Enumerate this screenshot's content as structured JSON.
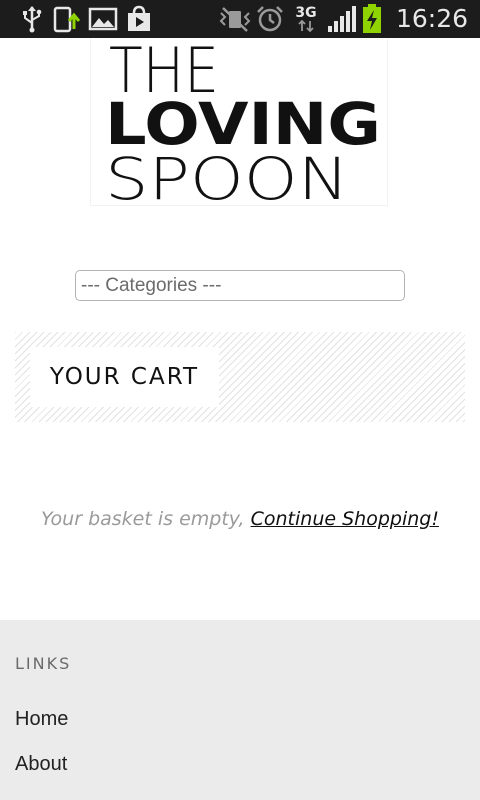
{
  "status_bar": {
    "time": "16:26",
    "network": "3G",
    "icons": [
      "usb-icon",
      "phone-upload-icon",
      "image-icon",
      "play-store-icon",
      "vibrate-off-icon",
      "alarm-icon",
      "network-3g-icon",
      "signal-icon",
      "battery-charging-icon"
    ],
    "battery_color": "#8fd400"
  },
  "logo": {
    "lines": [
      "THE",
      "LOVING",
      "SPOON"
    ]
  },
  "categories_select": {
    "selected": "--- Categories ---"
  },
  "cart": {
    "title": "YOUR CART",
    "empty_message": "Your basket is empty, ",
    "continue_link": "Continue Shopping!"
  },
  "footer": {
    "heading": "LINKS",
    "links": [
      {
        "label": "Home"
      },
      {
        "label": "About"
      }
    ]
  },
  "colors": {
    "status_bar_bg": "#1c1c1c",
    "footer_bg": "#ebebeb",
    "muted_text": "#9a9a9a"
  }
}
